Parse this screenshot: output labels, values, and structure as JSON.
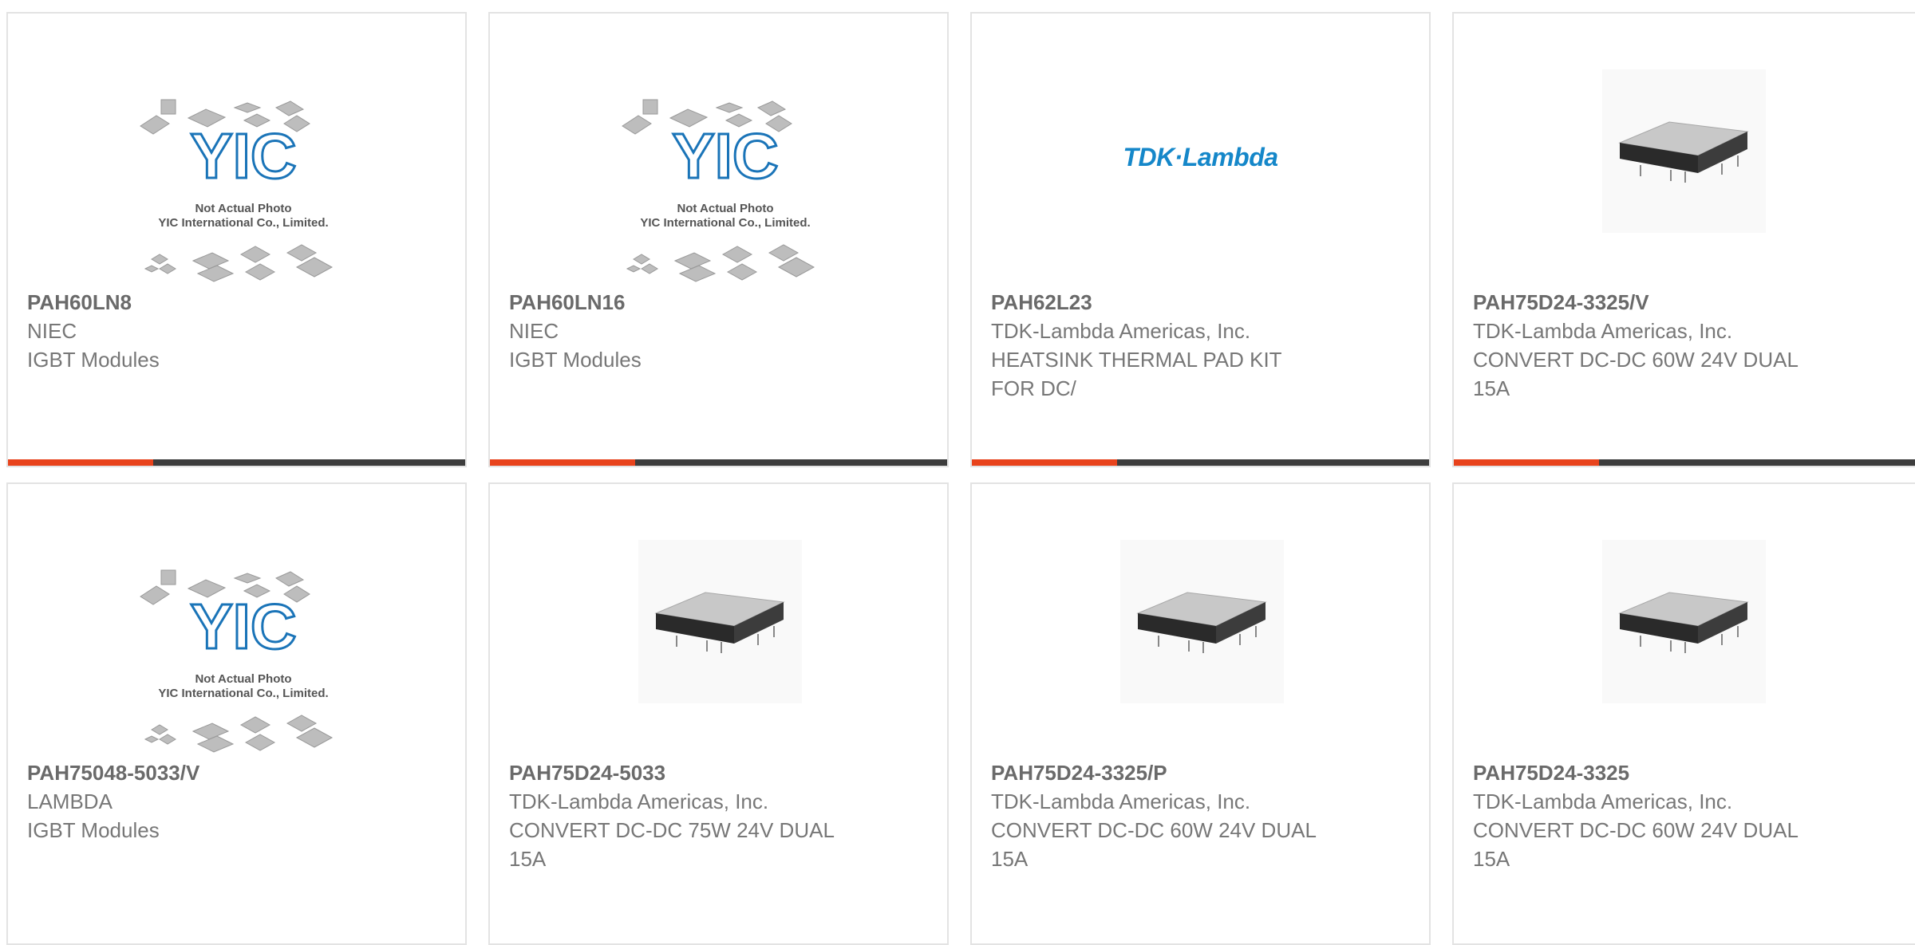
{
  "products": [
    {
      "part": "PAH60LN8",
      "maker": "NIEC",
      "desc": "IGBT Modules",
      "image": "yic-placeholder"
    },
    {
      "part": "PAH60LN16",
      "maker": "NIEC",
      "desc": "IGBT Modules",
      "image": "yic-placeholder"
    },
    {
      "part": "PAH62L23",
      "maker": "TDK-Lambda Americas, Inc.",
      "desc": "HEATSINK THERMAL PAD KIT FOR DC/",
      "image": "tdk-logo"
    },
    {
      "part": "PAH75D24-3325/V",
      "maker": "TDK-Lambda Americas, Inc.",
      "desc": "CONVERT DC-DC 60W 24V DUAL 15A",
      "image": "module-photo"
    },
    {
      "part": "PAH75048-5033/V",
      "maker": "LAMBDA",
      "desc": "IGBT Modules",
      "image": "yic-placeholder"
    },
    {
      "part": "PAH75D24-5033",
      "maker": "TDK-Lambda Americas, Inc.",
      "desc": "CONVERT DC-DC 75W 24V DUAL 15A",
      "image": "module-photo"
    },
    {
      "part": "PAH75D24-3325/P",
      "maker": "TDK-Lambda Americas, Inc.",
      "desc": "CONVERT DC-DC 60W 24V DUAL 15A",
      "image": "module-photo"
    },
    {
      "part": "PAH75D24-3325",
      "maker": "TDK-Lambda Americas, Inc.",
      "desc": "CONVERT DC-DC 60W 24V DUAL 15A",
      "image": "module-photo"
    }
  ],
  "placeholder": {
    "logo_text": "YIC",
    "line1": "Not Actual Photo",
    "line2": "YIC International Co., Limited."
  },
  "tdk_logo_text": "TDK·Lambda",
  "colors": {
    "accent": "#e8431c",
    "bar": "#3d3d3d",
    "yic_blue": "#1a74b8",
    "tdk_blue": "#1587c9"
  }
}
